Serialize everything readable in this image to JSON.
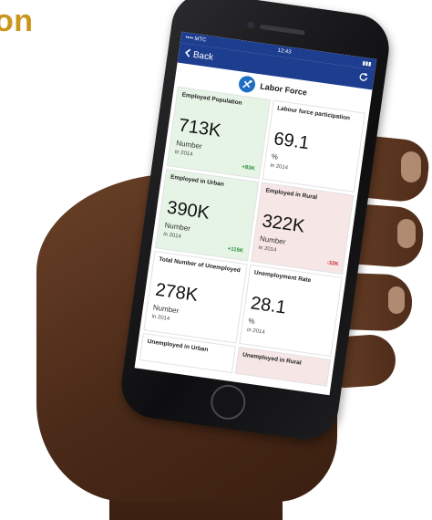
{
  "corner_text": "on",
  "status_bar": {
    "carrier": "•••• MTC",
    "time": "12:43",
    "battery": "▮▮▮"
  },
  "nav": {
    "back_label": "Back",
    "refresh_icon": "refresh-icon"
  },
  "header": {
    "title": "Labor Force",
    "icon": "tools-icon"
  },
  "colors": {
    "nav_blue": "#1d3d8f",
    "increase_green": "#2e8b3a",
    "decrease_red": "#d02a2a",
    "card_green": "#e6f4e6",
    "card_red": "#f7e6e6"
  },
  "cards": [
    {
      "title": "Employed Population",
      "value": "713K",
      "unit": "Number",
      "year": "in 2014",
      "change": "+83K",
      "tone": "green"
    },
    {
      "title": "Labour force participation",
      "value": "69.1",
      "unit": "%",
      "year": "in 2014",
      "change": "",
      "tone": "plain"
    },
    {
      "title": "Employed in Urban",
      "value": "390K",
      "unit": "Number",
      "year": "in 2014",
      "change": "+115K",
      "tone": "green"
    },
    {
      "title": "Employed in Rural",
      "value": "322K",
      "unit": "Number",
      "year": "in 2014",
      "change": "-32K",
      "tone": "red"
    },
    {
      "title": "Total Number of Unemployed",
      "value": "278K",
      "unit": "Number",
      "year": "in 2014",
      "change": "",
      "tone": "plain"
    },
    {
      "title": "Unemployment Rate",
      "value": "28.1",
      "unit": "%",
      "year": "in 2014",
      "change": "",
      "tone": "plain"
    },
    {
      "title": "Unemployed in Urban",
      "value": "",
      "unit": "",
      "year": "",
      "change": "",
      "tone": "plain"
    },
    {
      "title": "Unemployed in Rural",
      "value": "",
      "unit": "",
      "year": "",
      "change": "",
      "tone": "plain"
    }
  ]
}
